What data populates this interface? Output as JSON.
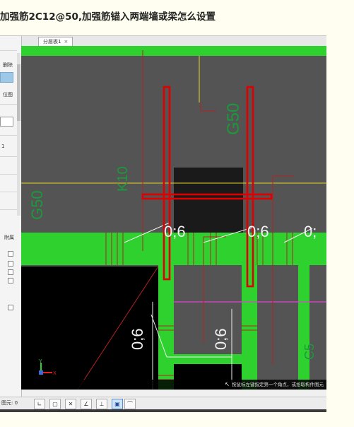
{
  "question": {
    "title": "加强筋2C12@50,加强筋锚入两端墙或梁怎么设置"
  },
  "tabs": [
    {
      "label": "分层板1",
      "close": "×"
    }
  ],
  "side_panel": {
    "labels": [
      "删除",
      "位图",
      "1",
      "附属"
    ]
  },
  "drawing": {
    "labels": [
      "0;6",
      "0;6",
      "0;",
      "0;6",
      "0;6",
      "K10",
      "G50",
      "G50",
      "C5"
    ],
    "colors": {
      "wall_green": "#2ed12e",
      "slab_gray": "#545454",
      "black_void": "#000000",
      "rebar_red": "#e00000",
      "grid_yellow": "#e6d21e",
      "line_magenta": "#e040d0",
      "text_white": "#f2f2f2",
      "text_green": "#1a9a3c"
    },
    "axis": {
      "y": "Y",
      "x": "X"
    }
  },
  "status_bar": {
    "hint": "按鼠标左键指定第一个角点，或拾取构件图元"
  },
  "bottom_toolbar": {
    "label": "图元: 0",
    "buttons": [
      {
        "icon": "ortho-icon",
        "glyph": "∟"
      },
      {
        "icon": "rect-select-icon",
        "glyph": "▢"
      },
      {
        "icon": "cross-icon",
        "glyph": "✕"
      },
      {
        "icon": "angle-icon",
        "glyph": "∠"
      },
      {
        "icon": "snap-icon",
        "glyph": "⊥"
      },
      {
        "icon": "grid-icon",
        "glyph": "▣"
      },
      {
        "icon": "arc-icon",
        "glyph": "⌒"
      }
    ]
  }
}
